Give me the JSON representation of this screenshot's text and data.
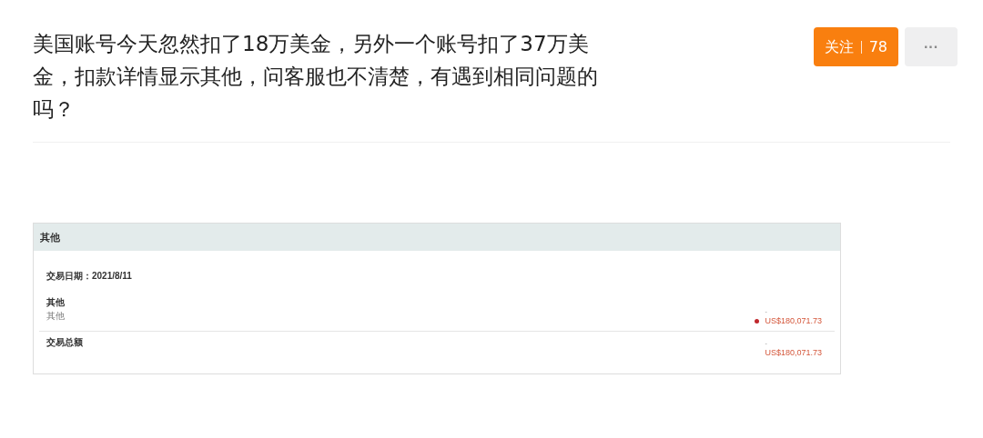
{
  "question": {
    "title": "美国账号今天忽然扣了18万美金，另外一个账号扣了37万美金，扣款详情显示其他，问客服也不清楚，有遇到相同问题的吗？"
  },
  "follow_button": {
    "label": "关注",
    "count": "78"
  },
  "more_button": {
    "label": "···"
  },
  "statement": {
    "header": "其他",
    "date_label": "交易日期：2021/8/11",
    "rows": [
      {
        "kind": "item",
        "title": "其他",
        "subtitle": "其他",
        "dash": "-",
        "amount": "US$180,071.73",
        "color": "#c0282d"
      },
      {
        "kind": "total",
        "title": "交易总额",
        "dash": "-",
        "amount": "US$180,071.73"
      }
    ]
  }
}
